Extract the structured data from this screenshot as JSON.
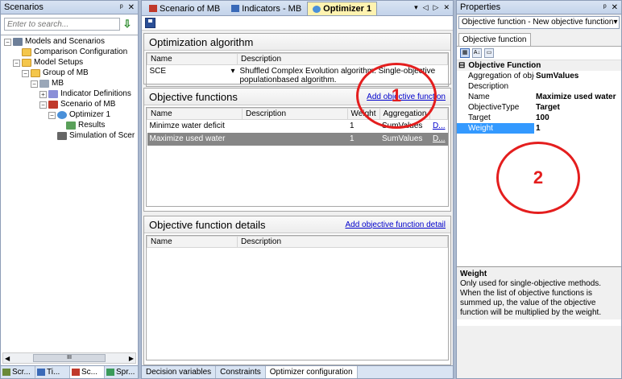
{
  "left": {
    "title": "Scenarios",
    "pin": "ᵖ",
    "close": "✕",
    "search_placeholder": "Enter to search...",
    "tree": [
      {
        "label": "Models and Scenarios",
        "indent": 0,
        "exp": "−",
        "icon": "models"
      },
      {
        "label": "Comparison Configuration",
        "indent": 1,
        "exp": "",
        "icon": "folder"
      },
      {
        "label": "Model Setups",
        "indent": 1,
        "exp": "−",
        "icon": "folder"
      },
      {
        "label": "Group of MB",
        "indent": 2,
        "exp": "−",
        "icon": "folder"
      },
      {
        "label": "MB",
        "indent": 3,
        "exp": "−",
        "icon": "model"
      },
      {
        "label": "Indicator Definitions",
        "indent": 4,
        "exp": "+",
        "icon": "indicator"
      },
      {
        "label": "Scenario of MB",
        "indent": 4,
        "exp": "−",
        "icon": "scenario"
      },
      {
        "label": "Optimizer 1",
        "indent": 5,
        "exp": "−",
        "icon": "optimizer"
      },
      {
        "label": "Results",
        "indent": 6,
        "exp": "",
        "icon": "results"
      },
      {
        "label": "Simulation of Scer",
        "indent": 5,
        "exp": "",
        "icon": "simulation"
      }
    ],
    "scroll_thumb": "III",
    "bottom_tabs": [
      {
        "label": "Scr...",
        "active": false
      },
      {
        "label": "Ti...",
        "active": false
      },
      {
        "label": "Sc...",
        "active": true
      },
      {
        "label": "Spr...",
        "active": false
      }
    ]
  },
  "center": {
    "tabs": [
      {
        "label": "Scenario of MB",
        "active": false
      },
      {
        "label": "Indicators - MB",
        "active": false
      },
      {
        "label": "Optimizer 1",
        "active": true
      }
    ],
    "algo": {
      "title": "Optimization algorithm",
      "headers": [
        "Name",
        "Description"
      ],
      "name_value": "SCE",
      "description": "Shuffled Complex Evolution algorithm. Single-objective populationbased algorithm."
    },
    "objectives": {
      "title": "Objective functions",
      "add_link": "Add objective function",
      "headers": [
        "Name",
        "Description",
        "Weight",
        "Aggregation"
      ],
      "rows": [
        {
          "name": "Minimze water deficit",
          "description": "",
          "weight": "1",
          "aggregation": "SumValues",
          "link": "D...",
          "selected": false
        },
        {
          "name": "Maximize used water",
          "description": "",
          "weight": "1",
          "aggregation": "SumValues",
          "link": "D...",
          "selected": true
        }
      ]
    },
    "details": {
      "title": "Objective function details",
      "add_link": "Add objective function detail",
      "headers": [
        "Name",
        "Description"
      ]
    },
    "bottom_tabs": [
      {
        "label": "Decision variables",
        "active": false
      },
      {
        "label": "Constraints",
        "active": false
      },
      {
        "label": "Optimizer configuration",
        "active": true
      }
    ]
  },
  "right": {
    "title": "Properties",
    "combo": "Objective function - New objective function",
    "tab": "Objective function",
    "category": "Objective Function",
    "props": [
      {
        "key": "Aggregation of obje",
        "value": "SumValues",
        "selected": false
      },
      {
        "key": "Description",
        "value": "",
        "selected": false
      },
      {
        "key": "Name",
        "value": "Maximize used water",
        "selected": false
      },
      {
        "key": "ObjectiveType",
        "value": "Target",
        "selected": false
      },
      {
        "key": "Target",
        "value": "100",
        "selected": false
      },
      {
        "key": "Weight",
        "value": "1",
        "selected": true
      }
    ],
    "help_title": "Weight",
    "help_text": "Only used for single-objective methods. When the list of objective functions is summed up, the value of the objective function will be multiplied by the weight."
  },
  "annotations": [
    {
      "label": "1"
    },
    {
      "label": "2"
    }
  ],
  "colors": {
    "annotation": "#e41e1e",
    "selected_row": "#868686",
    "selected_prop": "#3399ff",
    "active_tab": "#fff3b0"
  }
}
